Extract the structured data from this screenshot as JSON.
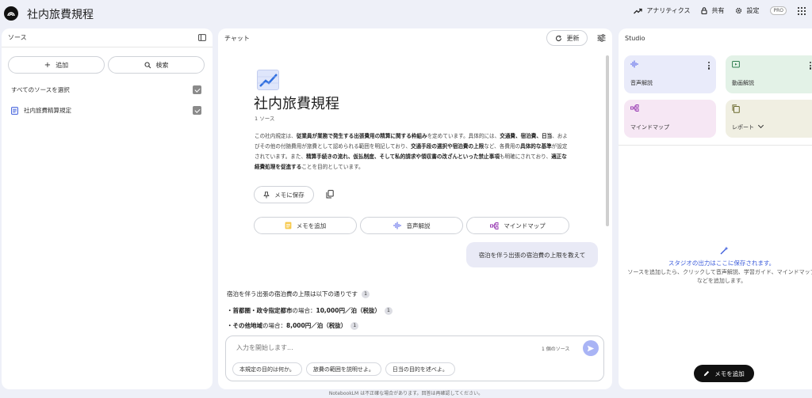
{
  "app": {
    "title": "社内旅費規程"
  },
  "topbar": {
    "analytics_label": "アナリティクス",
    "share_label": "共有",
    "settings_label": "設定",
    "pro_label": "PRO"
  },
  "sources": {
    "header": "ソース",
    "add_label": "追加",
    "search_label": "検索",
    "select_all_label": "すべてのソースを選択",
    "items": [
      {
        "label": "社内旅費精算規定"
      }
    ]
  },
  "chat": {
    "header": "チャット",
    "refresh_label": "更新",
    "doc_title": "社内旅費規程",
    "source_count": "1 ソース",
    "summary": {
      "s1": "この社内規定は、",
      "b1": "従業員が業務で発生する出張費用の精算に関する枠組み",
      "s2": "を定めています。具体的には、",
      "b2": "交通費、宿泊費、日当",
      "s3": "、およびその他の付随費用が旅費として認められる範囲を明記しており、",
      "b3": "交通手段の選択や宿泊費の上限",
      "s4": "など、各費用の",
      "b4": "具体的な基準",
      "s5": "が設定されています。また、",
      "b5": "精算手続きの流れ、仮払制度、そして私的請求や領収書の改ざんといった禁止事項",
      "s6": "も明確にされており、",
      "b6": "適正な経費処理を促進する",
      "s7": "ことを目的としています。"
    },
    "save_memo_label": "メモに保存",
    "actions": [
      {
        "label": "メモを追加"
      },
      {
        "label": "音声解説"
      },
      {
        "label": "マインドマップ"
      }
    ],
    "user_message": "宿泊を伴う出張の宿泊費の上限を教えて",
    "answer": {
      "intro": "宿泊を伴う出張の宿泊費の上限は以下の通りです",
      "line1_label": "・首都圏・政令指定都市",
      "line1_rest": "の場合：",
      "line1_value": "10,000円／泊（税抜）",
      "line2_label": "・その他地域",
      "line2_rest": "の場合：",
      "line2_value": "8,000円／泊（税抜）",
      "cite": "1"
    },
    "input_placeholder": "入力を開始します...",
    "source_count_small": "1 個のソース",
    "suggestions": [
      {
        "label": "本規定の目的は何か。"
      },
      {
        "label": "旅費の範囲を説明せよ。"
      },
      {
        "label": "日当の目的を述べよ。"
      }
    ]
  },
  "studio": {
    "header": "Studio",
    "cards": [
      {
        "label": "音声解説",
        "color": "#e9ebfa"
      },
      {
        "label": "動画解説",
        "color": "#e3f2e7"
      },
      {
        "label": "マインドマップ",
        "color": "#f6e7f4"
      },
      {
        "label": "レポート",
        "color": "#f0efe2"
      }
    ],
    "empty_title": "スタジオの出力はここに保存されます。",
    "empty_desc": "ソースを追加したら、クリックして音声解説、学習ガイド、マインドマップなどを追加します。",
    "add_memo_label": "メモを追加"
  },
  "footer": {
    "note": "NotebookLM は不正確な場合があります。回答は再確認してください。"
  },
  "colors": {
    "accent": "#3b5bdb",
    "send": "#a9b4f5"
  }
}
